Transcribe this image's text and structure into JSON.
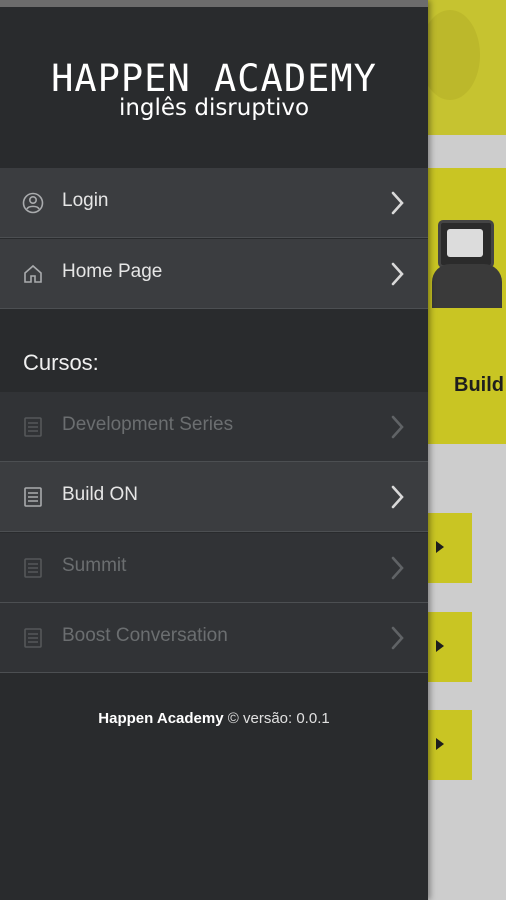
{
  "brand": {
    "title": "HAPPEN ACADEMY",
    "subtitle": "inglês disruptivo"
  },
  "menu": [
    {
      "label": "Login",
      "icon": "user-circle-icon",
      "enabled": true
    },
    {
      "label": "Home Page",
      "icon": "home-icon",
      "enabled": true
    }
  ],
  "courses_header": "Cursos:",
  "courses": [
    {
      "label": "Development Series",
      "icon": "book-icon",
      "enabled": false
    },
    {
      "label": "Build ON",
      "icon": "book-icon",
      "enabled": true
    },
    {
      "label": "Summit",
      "icon": "book-icon",
      "enabled": false
    },
    {
      "label": "Boost Conversation",
      "icon": "book-icon",
      "enabled": false
    }
  ],
  "footer": {
    "app_name": "Happen Academy",
    "version_text": "© versão: 0.0.1"
  },
  "background": {
    "card_title": "Build"
  },
  "colors": {
    "drawer": "#292b2d",
    "accent": "#c9c523"
  }
}
